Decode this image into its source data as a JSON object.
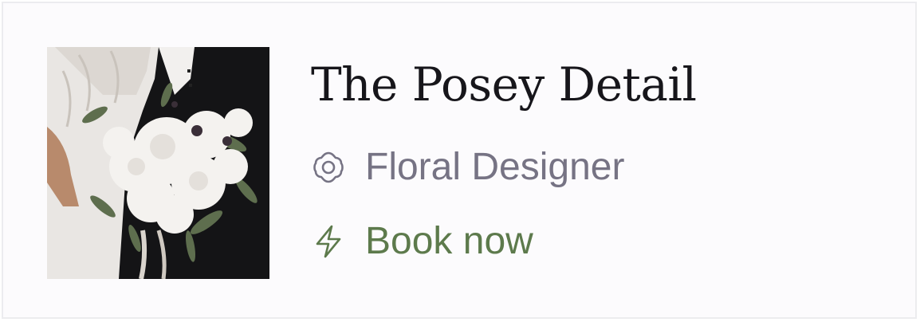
{
  "vendor": {
    "name": "The Posey Detail",
    "category": "Floral Designer",
    "category_icon": "flower-icon",
    "action_label": "Book now",
    "action_icon": "lightning-bolt-icon"
  },
  "colors": {
    "title": "#17161b",
    "category": "#767384",
    "action": "#5d7a4c",
    "card_background": "#fcfbfd",
    "card_border": "#ececef"
  },
  "photo": {
    "subject": "bridal-bouquet"
  }
}
